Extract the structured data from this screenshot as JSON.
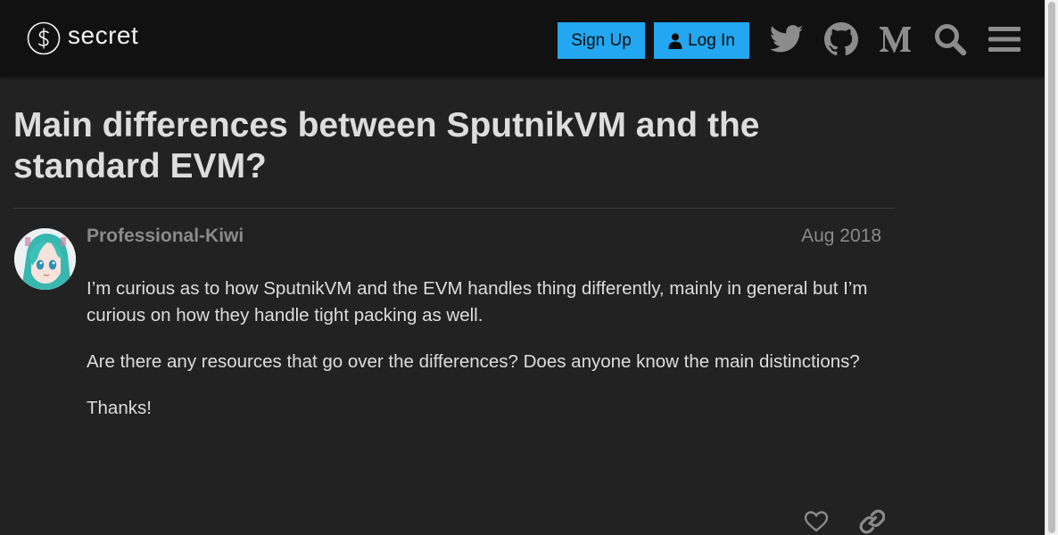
{
  "header": {
    "logo_text": "secret",
    "signup_label": "Sign Up",
    "login_label": "Log In",
    "icons": [
      "twitter-icon",
      "github-icon",
      "medium-icon",
      "search-icon",
      "menu-icon"
    ],
    "colors": {
      "header_bg": "#111111",
      "button_bg": "#22a7f0",
      "icon_color": "#8c8c8c"
    }
  },
  "topic": {
    "title": "Main differences between SputnikVM and the standard EVM?"
  },
  "post": {
    "username": "Professional-Kiwi",
    "date": "Aug 2018",
    "paragraphs": [
      "I’m curious as to how SputnikVM and the EVM handles thing differently, mainly in general but I’m curious on how they handle tight packing as well.",
      "Are there any resources that go over the differences? Does anyone know the main distinctions?",
      "Thanks!"
    ],
    "actions": [
      "like-icon",
      "link-icon"
    ]
  },
  "colors": {
    "page_bg": "#222222",
    "text": "#dddddd",
    "muted": "#8a8a8a"
  }
}
